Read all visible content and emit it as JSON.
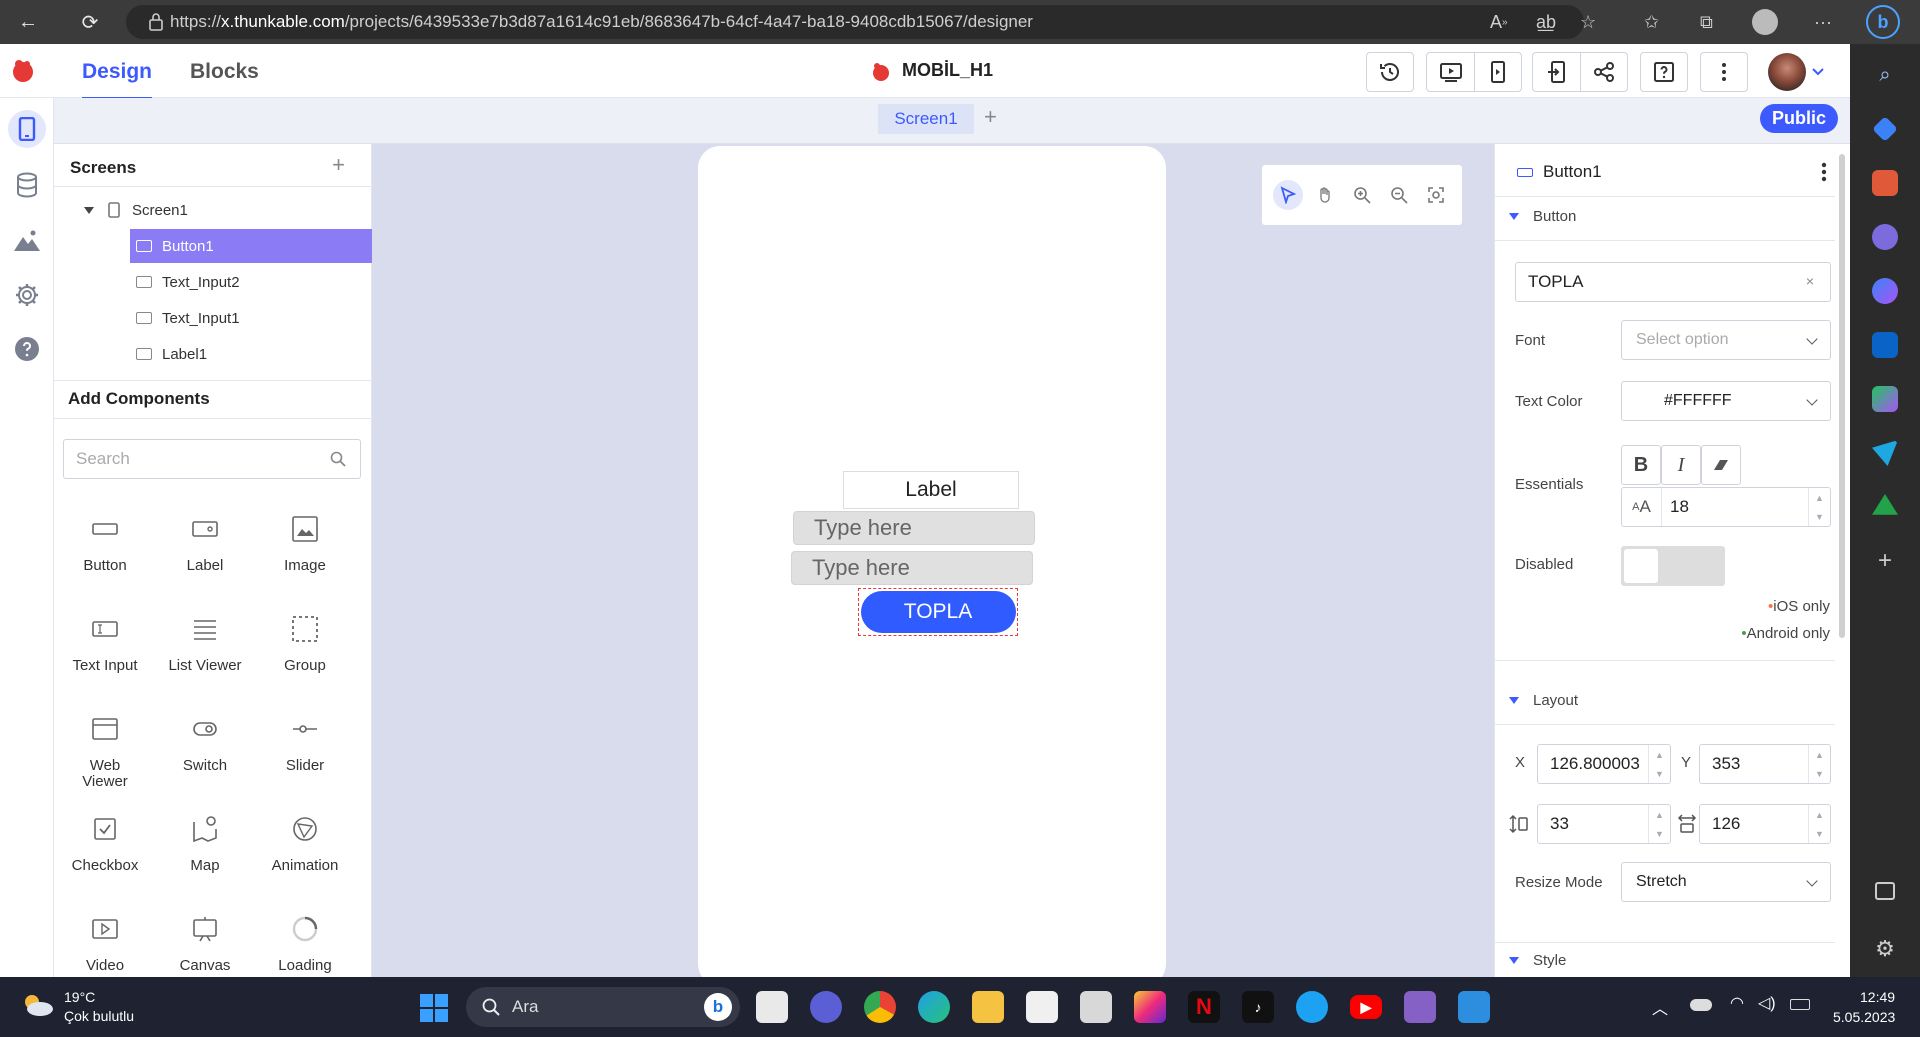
{
  "browser": {
    "url_prefix": "https://",
    "url_host": "x.thunkable.com",
    "url_path": "/projects/6439533e7b3d87a1614c91eb/8683647b-64cf-4a47-ba18-9408cdb15067/designer"
  },
  "header": {
    "tabs": {
      "design": "Design",
      "blocks": "Blocks"
    },
    "project_title": "MOBİL_H1",
    "accent_color": "#3d5afe"
  },
  "screen_tabs": {
    "active": "Screen1",
    "add": "+",
    "public_label": "Public"
  },
  "screens_panel": {
    "title": "Screens",
    "add": "+",
    "tree": {
      "screen": "Screen1",
      "children": [
        "Button1",
        "Text_Input2",
        "Text_Input1",
        "Label1"
      ]
    }
  },
  "add_components": {
    "title": "Add Components",
    "search_placeholder": "Search",
    "items": [
      {
        "label": "Button",
        "icon": "button-icon"
      },
      {
        "label": "Label",
        "icon": "label-icon"
      },
      {
        "label": "Image",
        "icon": "image-icon"
      },
      {
        "label": "Text Input",
        "icon": "text-input-icon"
      },
      {
        "label": "List Viewer",
        "icon": "list-icon"
      },
      {
        "label": "Group",
        "icon": "group-icon"
      },
      {
        "label": "Web Viewer",
        "icon": "web-viewer-icon"
      },
      {
        "label": "Switch",
        "icon": "switch-icon"
      },
      {
        "label": "Slider",
        "icon": "slider-icon"
      },
      {
        "label": "Checkbox",
        "icon": "checkbox-icon"
      },
      {
        "label": "Map",
        "icon": "map-icon"
      },
      {
        "label": "Animation",
        "icon": "animation-icon"
      },
      {
        "label": "Video",
        "icon": "video-icon"
      },
      {
        "label": "Canvas",
        "icon": "canvas-icon"
      },
      {
        "label": "Loading",
        "icon": "loading-icon"
      }
    ]
  },
  "canvas": {
    "label_text": "Label",
    "text_input_1_placeholder": "Type here",
    "text_input_2_placeholder": "Type here",
    "button_text": "TOPLA",
    "button_color": "#2f5bff"
  },
  "properties": {
    "component_name": "Button1",
    "section_button": "Button",
    "text_value": "TOPLA",
    "clear": "×",
    "font_label": "Font",
    "font_placeholder": "Select option",
    "text_color_label": "Text Color",
    "text_color_value": "#FFFFFF",
    "essentials_label": "Essentials",
    "font_size": "18",
    "disabled_label": "Disabled",
    "ios_only": "iOS only",
    "android_only": "Android only",
    "section_layout": "Layout",
    "x_label": "X",
    "x_value": "126.800003",
    "y_label": "Y",
    "y_value": "353",
    "height_value": "33",
    "width_value": "126",
    "resize_mode_label": "Resize Mode",
    "resize_mode_value": "Stretch",
    "section_style": "Style"
  },
  "taskbar": {
    "temperature": "19°C",
    "weather": "Çok bulutlu",
    "search_label": "Ara",
    "time": "12:49",
    "date": "5.05.2023"
  }
}
